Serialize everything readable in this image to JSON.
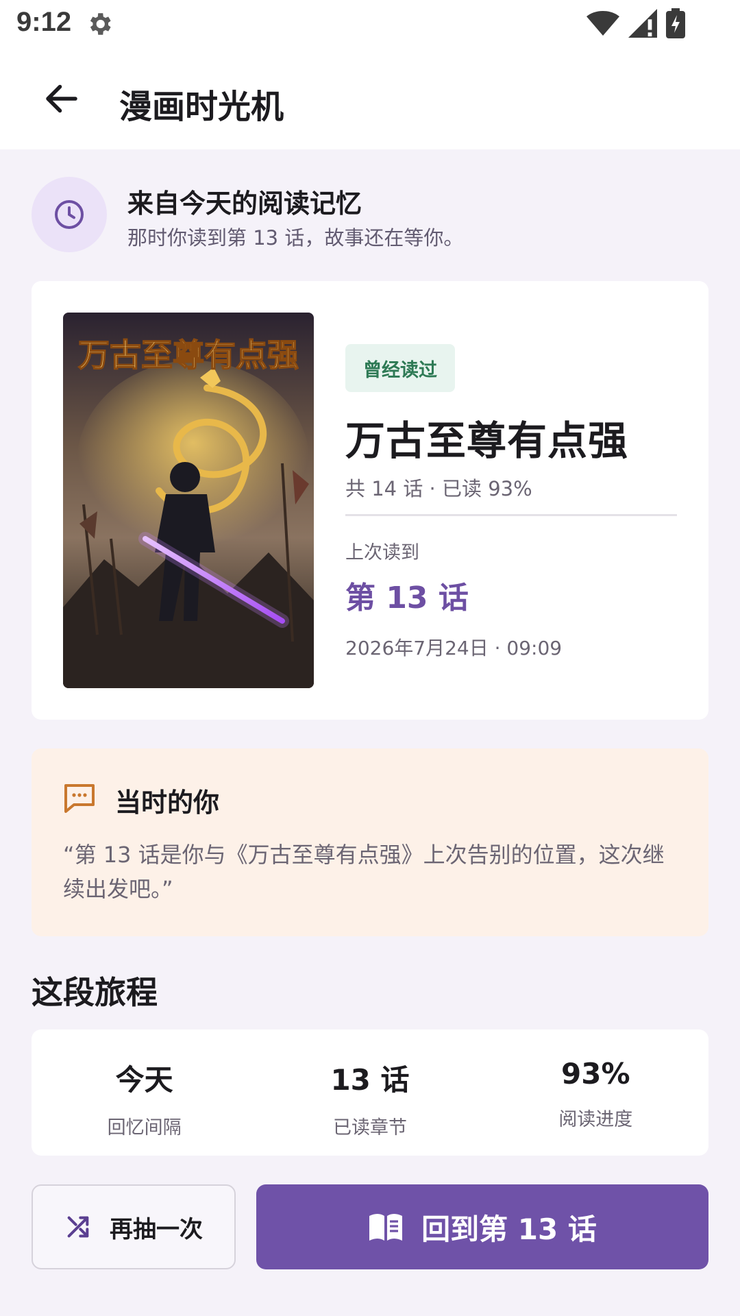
{
  "status_bar": {
    "time": "9:12"
  },
  "app_bar": {
    "title": "漫画时光机"
  },
  "memory": {
    "title": "来自今天的阅读记忆",
    "subtitle": "那时你读到第 13 话，故事还在等你。"
  },
  "book": {
    "cover_title": "万古至尊有点强",
    "badge": "曾经读过",
    "title": "万古至尊有点强",
    "meta": "共 14 话 · 已读 93%",
    "last_read_label": "上次读到",
    "last_read_episode": "第 13 话",
    "last_read_time": "2026年7月24日 · 09:09"
  },
  "then_you": {
    "title": "当时的你",
    "quote": "“第 13 话是你与《万古至尊有点强》上次告别的位置，这次继续出发吧。”"
  },
  "journey": {
    "title": "这段旅程",
    "stats": [
      {
        "value": "今天",
        "label": "回忆间隔"
      },
      {
        "value": "13 话",
        "label": "已读章节"
      },
      {
        "value": "93%",
        "label": "阅读进度"
      }
    ]
  },
  "actions": {
    "redraw_label": "再抽一次",
    "return_label": "回到第 13 话"
  },
  "colors": {
    "accent": "#6f52a8",
    "badge_green": "#2e7a55",
    "warm_bg": "#fdf1e8"
  }
}
